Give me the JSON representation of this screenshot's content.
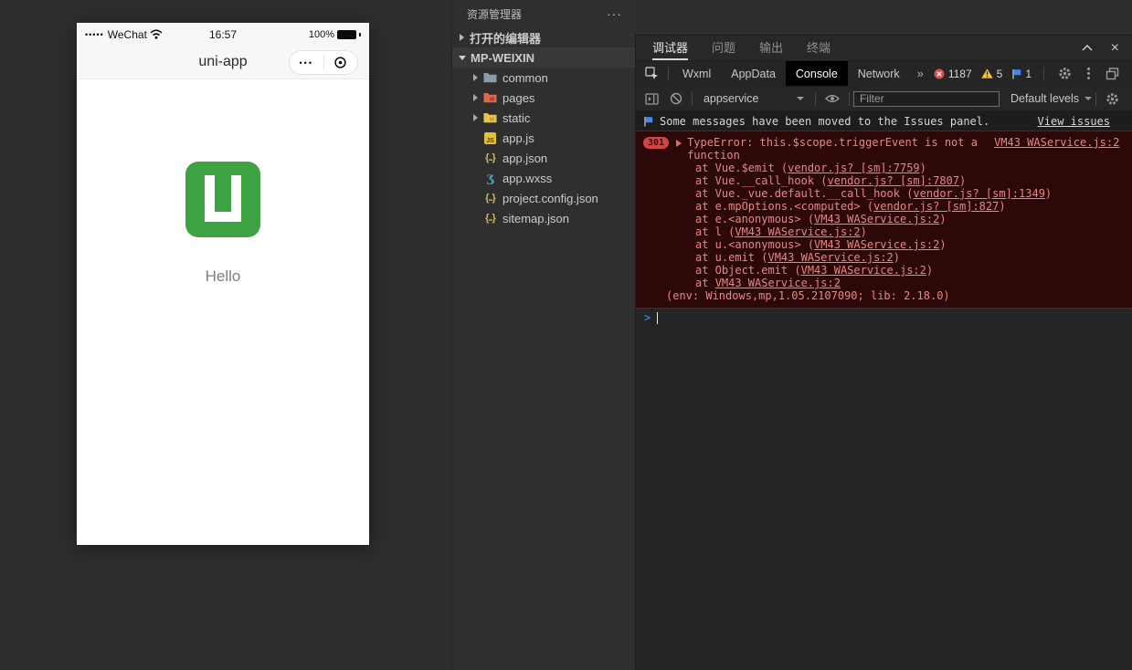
{
  "simulator": {
    "status_bar": {
      "signal": "•••••",
      "carrier": "WeChat",
      "time": "16:57",
      "battery_pct": "100%"
    },
    "nav": {
      "title": "uni-app",
      "capsule_dots": "•••"
    },
    "content": {
      "hello": "Hello"
    }
  },
  "explorer": {
    "header": {
      "title": "资源管理器",
      "more": "···"
    },
    "open_editors_label": "打开的编辑器",
    "root_label": "MP-WEIXIN",
    "tree": [
      {
        "name": "common"
      },
      {
        "name": "pages"
      },
      {
        "name": "static"
      },
      {
        "name": "app.js"
      },
      {
        "name": "app.json"
      },
      {
        "name": "app.wxss"
      },
      {
        "name": "project.config.json"
      },
      {
        "name": "sitemap.json"
      }
    ],
    "icon_labels": {
      "js": "JS",
      "json": "{..}",
      "wxss": "ʒ"
    }
  },
  "debugger": {
    "tabs": [
      {
        "label": "调试器"
      },
      {
        "label": "问题"
      },
      {
        "label": "输出"
      },
      {
        "label": "终端"
      }
    ],
    "window_buttons": {
      "close": "×"
    },
    "devtools_tabs": [
      {
        "label": "Wxml"
      },
      {
        "label": "AppData"
      },
      {
        "label": "Console"
      },
      {
        "label": "Network"
      }
    ],
    "overflow_symbol": "»",
    "badges": {
      "errors": "1187",
      "warnings": "5",
      "messages": "1"
    },
    "toolbar": {
      "context": "appservice",
      "filter_placeholder": "Filter",
      "levels": "Default levels"
    },
    "info_bar": {
      "text": "Some messages have been moved to the Issues panel.",
      "link": "View issues"
    },
    "console": {
      "error": {
        "count": "301",
        "message": "TypeError: this.$scope.triggerEvent is not a function",
        "source": "VM43 WAService.js:2",
        "stack": [
          {
            "pre": "at Vue.$emit (",
            "link": "vendor.js? [sm]:7759",
            "post": ")"
          },
          {
            "pre": "at Vue.__call_hook (",
            "link": "vendor.js? [sm]:7807",
            "post": ")"
          },
          {
            "pre": "at Vue._vue.default.__call_hook (",
            "link": "vendor.js? [sm]:1349",
            "post": ")"
          },
          {
            "pre": "at e.mpOptions.<computed> (",
            "link": "vendor.js? [sm]:827",
            "post": ")"
          },
          {
            "pre": "at e.<anonymous> (",
            "link": "VM43 WAService.js:2",
            "post": ")"
          },
          {
            "pre": "at l (",
            "link": "VM43 WAService.js:2",
            "post": ")"
          },
          {
            "pre": "at u.<anonymous> (",
            "link": "VM43 WAService.js:2",
            "post": ")"
          },
          {
            "pre": "at u.emit (",
            "link": "VM43 WAService.js:2",
            "post": ")"
          },
          {
            "pre": "at Object.emit (",
            "link": "VM43 WAService.js:2",
            "post": ")"
          },
          {
            "pre": "at ",
            "link": "VM43 WAService.js:2",
            "post": ""
          }
        ],
        "env": "(env: Windows,mp,1.05.2107090; lib: 2.18.0)"
      },
      "prompt_symbol": ">"
    }
  },
  "colors": {
    "app_green": "#3da342",
    "error_bg": "#2d0808",
    "error_text": "#e98585",
    "badge_red": "#d14545",
    "warning_yellow": "#f3c53a",
    "info_blue": "#4286f5",
    "active_tab_bg": "#000000"
  }
}
